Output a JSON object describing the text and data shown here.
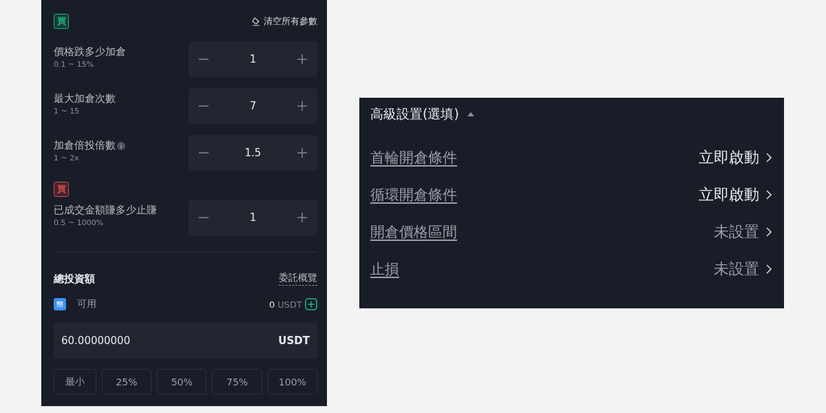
{
  "grid_form": {
    "side_badge": {
      "text": "買",
      "color": "#1fb57a"
    },
    "clear_button": "清空所有參數",
    "params": [
      {
        "label": "價格跌多少加倉",
        "range": "0.1 ~ 15%",
        "value": "1",
        "info": false
      },
      {
        "label": "最大加倉次數",
        "range": "1 ~ 15",
        "value": "7",
        "info": false
      },
      {
        "label": "加倉倍投倍數",
        "range": "1 ~ 2x",
        "value": "1.5",
        "info": true
      },
      {
        "badge": {
          "text": "買",
          "color": "#e0484f"
        },
        "label": "已成交金額賺多少止賺",
        "range": "0.5 ~ 1000%",
        "value": "1",
        "info": false
      }
    ],
    "investment": {
      "title": "總投資額",
      "overview_link": "委託概覽",
      "coin_badge": {
        "text": "幣",
        "color": "#3d8ef0"
      },
      "available_label": "可用",
      "available_amount": "0",
      "available_unit": "USDT",
      "amount_value": "60.00000000",
      "amount_unit": "USDT",
      "quick_buttons": [
        {
          "label": "最小",
          "selected": false
        },
        {
          "label": "25%",
          "selected": false
        },
        {
          "label": "50%",
          "selected": false
        },
        {
          "label": "75%",
          "selected": false
        },
        {
          "label": "100%",
          "selected": false
        }
      ]
    }
  },
  "advanced": {
    "title": "高級設置(選填)",
    "expanded": true,
    "rows": [
      {
        "label": "首輪開倉條件",
        "value": "立即啟動",
        "configured": true
      },
      {
        "label": "循環開倉條件",
        "value": "立即啟動",
        "configured": true
      },
      {
        "label": "開倉價格區間",
        "value": "未設置",
        "configured": false
      },
      {
        "label": "止損",
        "value": "未設置",
        "configured": false
      }
    ]
  }
}
